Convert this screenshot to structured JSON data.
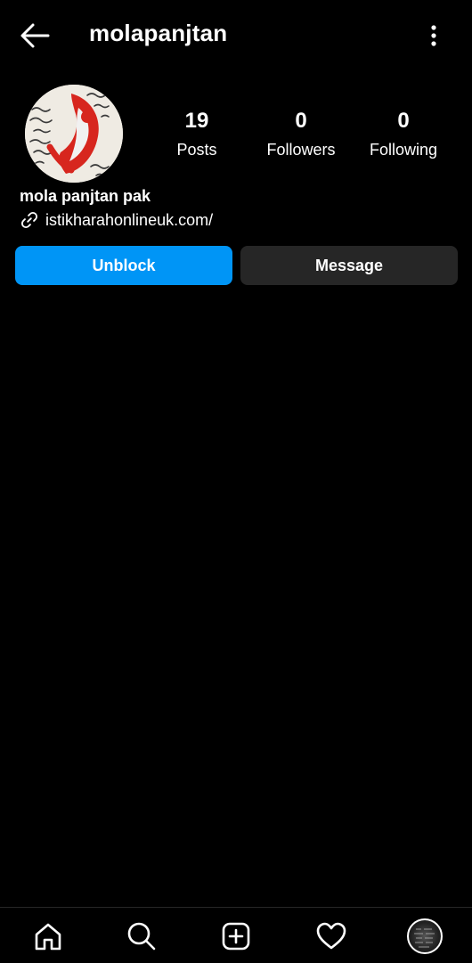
{
  "header": {
    "username": "molapanjtan",
    "back_icon": "arrow-left-icon",
    "more_icon": "more-vertical-icon"
  },
  "profile": {
    "display_name": "mola panjtan pak",
    "website": "istikharahonlineuk.com/",
    "stats": {
      "posts": {
        "count": "19",
        "label": "Posts"
      },
      "followers": {
        "count": "0",
        "label": "Followers"
      },
      "following": {
        "count": "0",
        "label": "Following"
      }
    }
  },
  "actions": {
    "unblock_label": "Unblock",
    "message_label": "Message"
  },
  "nav": {
    "items": [
      "home-icon",
      "search-icon",
      "new-post-icon",
      "heart-icon",
      "profile-avatar"
    ]
  },
  "colors": {
    "background": "#000000",
    "primary": "#0095f6",
    "secondary_button": "#262626",
    "text": "#ffffff"
  }
}
